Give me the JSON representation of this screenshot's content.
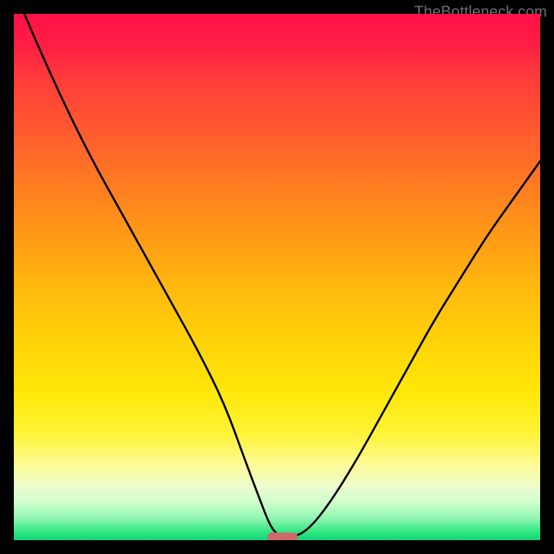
{
  "watermark": {
    "text": "TheBottleneck.com"
  },
  "chart_data": {
    "type": "line",
    "title": "",
    "xlabel": "",
    "ylabel": "",
    "xlim": [
      0,
      100
    ],
    "ylim": [
      0,
      100
    ],
    "grid": false,
    "gradient_stops": [
      {
        "pos": 0,
        "color": "#ff1149"
      },
      {
        "pos": 6,
        "color": "#ff1e44"
      },
      {
        "pos": 12,
        "color": "#ff3b3b"
      },
      {
        "pos": 22,
        "color": "#ff5a2f"
      },
      {
        "pos": 32,
        "color": "#ff7a22"
      },
      {
        "pos": 42,
        "color": "#ff9a16"
      },
      {
        "pos": 52,
        "color": "#ffb80e"
      },
      {
        "pos": 62,
        "color": "#ffd208"
      },
      {
        "pos": 72,
        "color": "#ffe708"
      },
      {
        "pos": 80,
        "color": "#fff43a"
      },
      {
        "pos": 86,
        "color": "#fbfb9a"
      },
      {
        "pos": 90,
        "color": "#ecfccf"
      },
      {
        "pos": 93,
        "color": "#cdfdcd"
      },
      {
        "pos": 96,
        "color": "#8cf5b0"
      },
      {
        "pos": 98.5,
        "color": "#2de780"
      },
      {
        "pos": 100,
        "color": "#13d47a"
      }
    ],
    "series": [
      {
        "name": "bottleneck-curve",
        "x": [
          2,
          5,
          10,
          15,
          20,
          25,
          30,
          35,
          40,
          44,
          47,
          49,
          51,
          53,
          56,
          60,
          65,
          70,
          75,
          80,
          85,
          90,
          95,
          100
        ],
        "y": [
          100,
          93,
          82,
          72,
          63,
          54,
          45,
          36,
          26,
          15,
          7,
          2,
          0.5,
          0.5,
          2,
          7,
          15,
          24,
          33,
          42,
          50,
          58,
          65,
          72
        ]
      }
    ],
    "marker": {
      "x": 51,
      "y": 0.5,
      "color": "#cf6a6c"
    }
  }
}
